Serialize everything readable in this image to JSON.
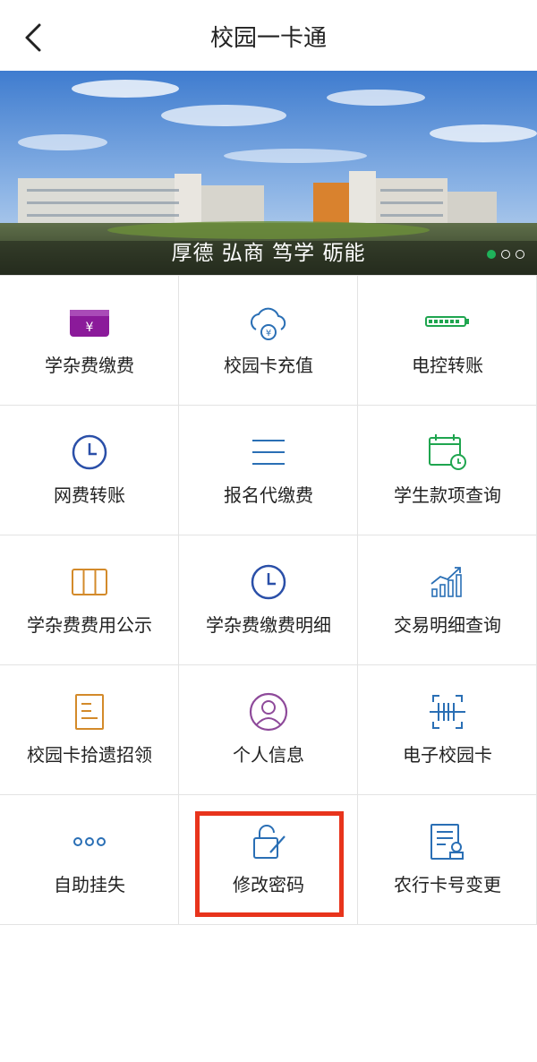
{
  "header": {
    "title": "校园一卡通",
    "back_icon": "chevron-left-icon"
  },
  "banner": {
    "slogan": "厚德 弘商 笃学 砺能",
    "dots_total": 3,
    "active_dot": 1
  },
  "grid": {
    "items": [
      {
        "label": "学杂费缴费",
        "icon": "wallet-yen-icon"
      },
      {
        "label": "校园卡充值",
        "icon": "cloud-yen-icon"
      },
      {
        "label": "电控转账",
        "icon": "battery-icon"
      },
      {
        "label": "网费转账",
        "icon": "clock-icon"
      },
      {
        "label": "报名代缴费",
        "icon": "menu-lines-icon"
      },
      {
        "label": "学生款项查询",
        "icon": "calendar-clock-icon"
      },
      {
        "label": "学杂费费用公示",
        "icon": "columns-icon"
      },
      {
        "label": "学杂费缴费明细",
        "icon": "clock-icon"
      },
      {
        "label": "交易明细查询",
        "icon": "bar-chart-icon"
      },
      {
        "label": "校园卡拾遗招领",
        "icon": "document-icon"
      },
      {
        "label": "个人信息",
        "icon": "user-icon"
      },
      {
        "label": "电子校园卡",
        "icon": "scan-icon"
      },
      {
        "label": "自助挂失",
        "icon": "more-dots-icon"
      },
      {
        "label": "修改密码",
        "icon": "lock-edit-icon"
      },
      {
        "label": "农行卡号变更",
        "icon": "certificate-icon"
      }
    ]
  },
  "colors": {
    "highlight": "#e8341c",
    "active_dot": "#1fb25a",
    "purple": "#8b1a9a",
    "blue": "#2a6fb5",
    "green": "#1fa54f",
    "orange": "#d38a2a"
  }
}
